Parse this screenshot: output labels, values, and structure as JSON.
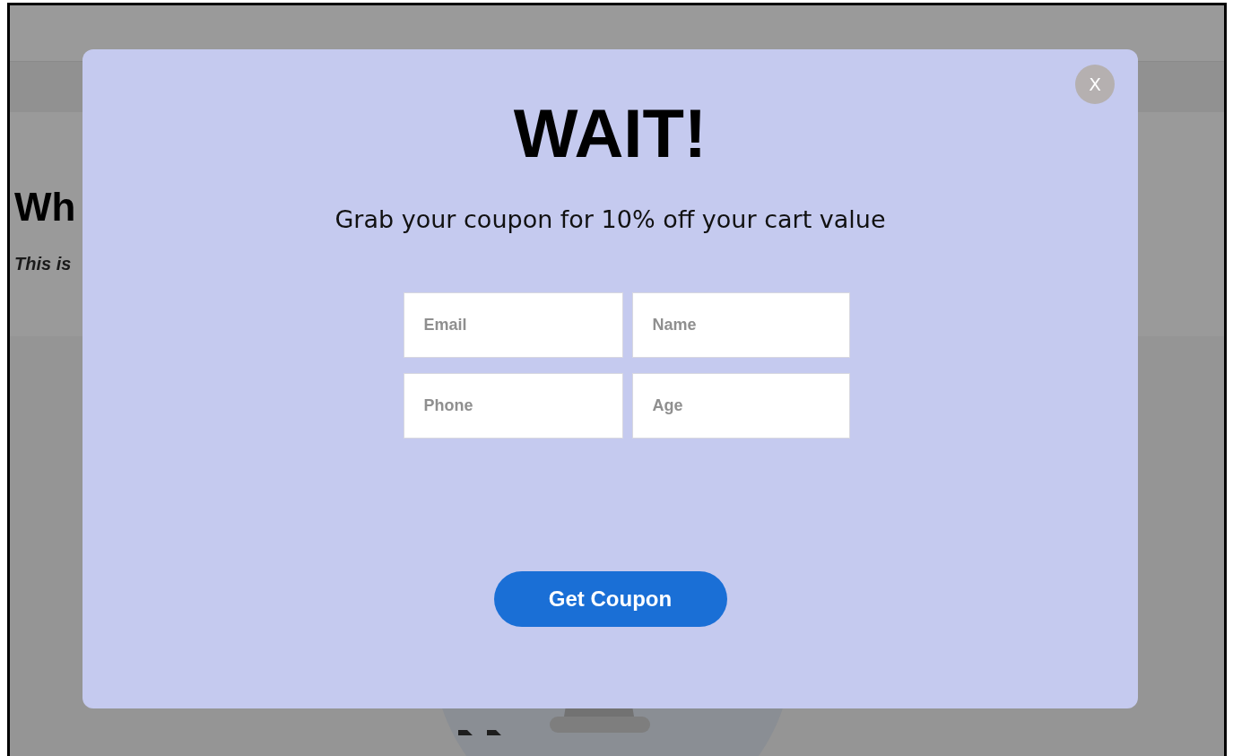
{
  "page": {
    "heading": "Wh",
    "intro": "This is"
  },
  "popup": {
    "close": "X",
    "title": "WAIT!",
    "subtitle": "Grab your coupon for 10% off your cart value",
    "fields": [
      {
        "placeholder": "Email"
      },
      {
        "placeholder": "Name"
      },
      {
        "placeholder": "Phone"
      },
      {
        "placeholder": "Age"
      }
    ],
    "button": "Get Coupon"
  }
}
